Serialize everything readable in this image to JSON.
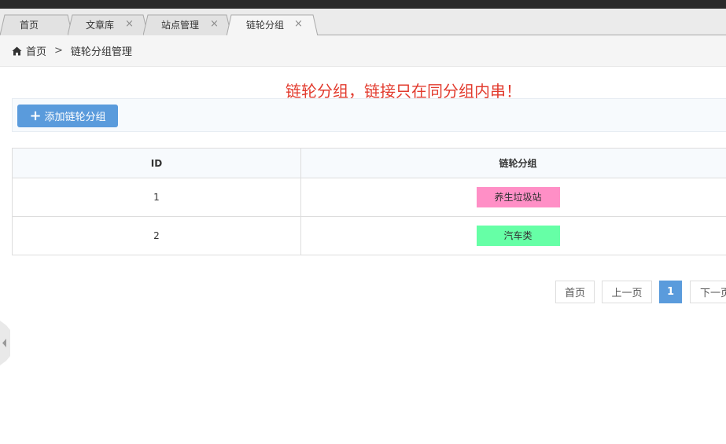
{
  "tabs": [
    {
      "label": "首页",
      "closable": false
    },
    {
      "label": "文章库",
      "closable": true
    },
    {
      "label": "站点管理",
      "closable": true
    },
    {
      "label": "链轮分组",
      "closable": true,
      "active": true
    }
  ],
  "close_glyph": "×",
  "breadcrumb": {
    "home": "首页",
    "separator": ">",
    "current": "链轮分组管理"
  },
  "notice": "链轮分组，链接只在同分组内串！",
  "toolbar": {
    "add_button": "添加链轮分组"
  },
  "table": {
    "headers": [
      "ID",
      "链轮分组"
    ],
    "rows": [
      {
        "id": "1",
        "group": "养生垃圾站",
        "color": "#ff8fc6"
      },
      {
        "id": "2",
        "group": "汽车类",
        "color": "#66ffa6"
      }
    ]
  },
  "pagination": {
    "first": "首页",
    "prev": "上一页",
    "current": "1",
    "next": "下一页"
  },
  "colors": {
    "accent": "#5a9bdc",
    "notice": "#e23b2e"
  }
}
